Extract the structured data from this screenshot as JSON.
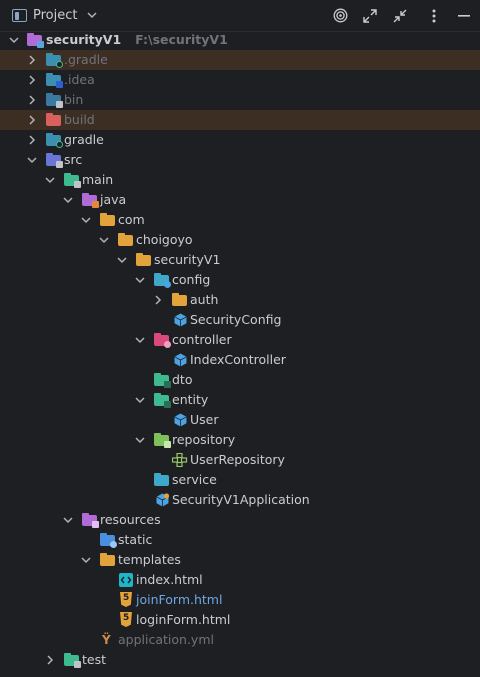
{
  "header": {
    "title": "Project"
  },
  "tree": {
    "root": {
      "label": "securityV1",
      "path": "F:\\securityV1"
    },
    "gradle_hidden": ".gradle",
    "idea": ".idea",
    "bin": "bin",
    "build": "build",
    "gradle": "gradle",
    "src": "src",
    "main": "main",
    "java": "java",
    "com": "com",
    "choigoyo": "choigoyo",
    "pkg": "securityV1",
    "config": "config",
    "auth": "auth",
    "security_config": "SecurityConfig",
    "controller": "controller",
    "index_controller": "IndexController",
    "dto": "dto",
    "entity": "entity",
    "user": "User",
    "repository": "repository",
    "user_repository": "UserRepository",
    "service": "service",
    "app": "SecurityV1Application",
    "resources": "resources",
    "static": "static",
    "templates": "templates",
    "index_html": "index.html",
    "join_form": "joinForm.html",
    "login_form": "loginForm.html",
    "app_yml": "application.yml",
    "test": "test"
  },
  "colors": {
    "background": "#1e1f22",
    "excluded_row": "#3d2e23",
    "folder_yellow": "#e2a33a",
    "folder_blue": "#5ea3d8",
    "source_green": "#3fb98f",
    "java_purple": "#b06bd6",
    "class_blue": "#4ba3e3"
  },
  "icons": [
    "project-icon",
    "target-icon",
    "expand-icon",
    "collapse-icon",
    "more-icon",
    "minimize-icon",
    "chevron-down-icon",
    "chevron-right-icon"
  ]
}
